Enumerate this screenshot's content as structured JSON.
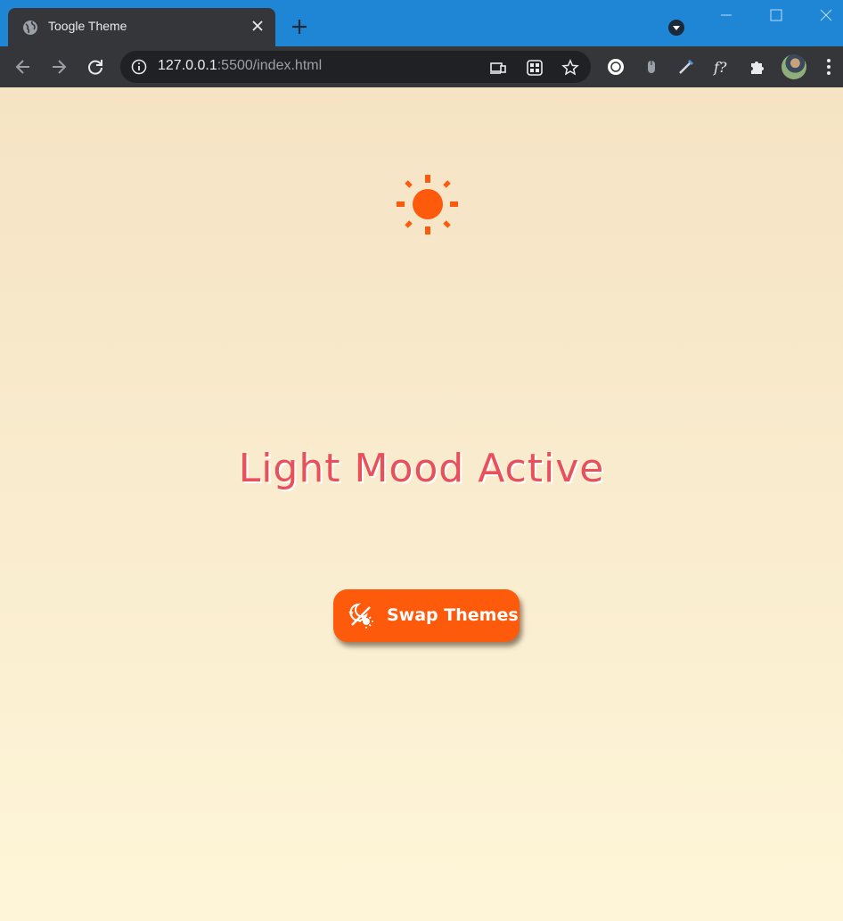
{
  "browser": {
    "tab": {
      "title": "Toogle Theme"
    },
    "address": {
      "host": "127.0.0.1",
      "rest": ":5500/index.html"
    },
    "toolbar_icons": [
      "back-arrow-icon",
      "forward-arrow-icon",
      "reload-icon",
      "site-info-icon",
      "cast-icon",
      "qr-code-icon",
      "bookmark-star-icon",
      "extension-icons",
      "puzzle-icon",
      "profile-avatar",
      "kebab-menu-icon"
    ]
  },
  "page": {
    "headline": "Light Mood Active",
    "button_label": "Swap Themes",
    "icons": {
      "sun": "sun-icon",
      "button": "sun-moon-toggle-icon"
    },
    "colors": {
      "accent": "#fd5a0c",
      "headline": "#e8505b",
      "background_top": "#f5e3c4",
      "background_bottom": "#fef5d8"
    }
  }
}
